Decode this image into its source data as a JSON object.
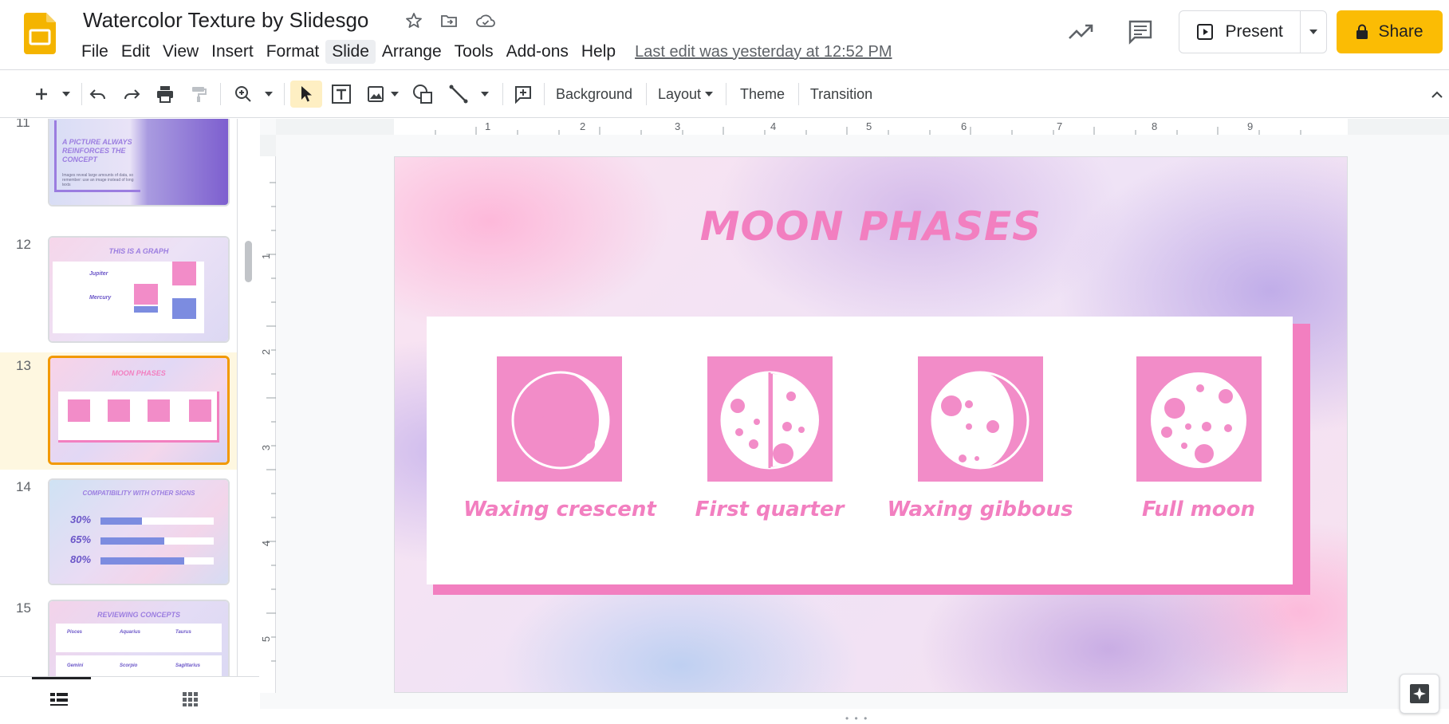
{
  "app": {
    "doc_title": "Watercolor Texture by Slidesgo",
    "menus": [
      "File",
      "Edit",
      "View",
      "Insert",
      "Format",
      "Slide",
      "Arrange",
      "Tools",
      "Add-ons",
      "Help"
    ],
    "last_edit": "Last edit was yesterday at 12:52 PM",
    "present_label": "Present",
    "share_label": "Share"
  },
  "toolbar": {
    "background_label": "Background",
    "layout_label": "Layout",
    "theme_label": "Theme",
    "transition_label": "Transition"
  },
  "filmstrip": {
    "slides": [
      {
        "num": "11",
        "title": "A PICTURE ALWAYS REINFORCES THE CONCEPT",
        "body": "Images reveal large amounts of data, so remember: use an image instead of long texts"
      },
      {
        "num": "12",
        "title": "THIS IS A GRAPH",
        "items": [
          "Jupiter",
          "Mercury"
        ]
      },
      {
        "num": "13",
        "title": "MOON PHASES",
        "selected": true
      },
      {
        "num": "14",
        "title": "COMPATIBILITY WITH OTHER SIGNS",
        "bars": [
          {
            "label": "30%",
            "value": 0.3
          },
          {
            "label": "65%",
            "value": 0.65
          },
          {
            "label": "80%",
            "value": 0.8
          }
        ]
      },
      {
        "num": "15",
        "title": "REVIEWING CONCEPTS",
        "cols": [
          "Pisces",
          "Aquarius",
          "Taurus",
          "Gemini",
          "Scorpio",
          "Sagittarius"
        ]
      }
    ]
  },
  "ruler": {
    "top": [
      "1",
      "2",
      "3",
      "4",
      "5",
      "6",
      "7",
      "8",
      "9"
    ],
    "left": [
      "1",
      "2",
      "3",
      "4",
      "5"
    ]
  },
  "slide": {
    "title": "MOON PHASES",
    "phases": [
      {
        "label": "Waxing crescent"
      },
      {
        "label": "First quarter"
      },
      {
        "label": "Waxing gibbous"
      },
      {
        "label": "Full moon"
      }
    ]
  },
  "colors": {
    "accent_pink": "#f27fc0",
    "share_yellow": "#fbbc04",
    "selected_border": "#f29900"
  }
}
